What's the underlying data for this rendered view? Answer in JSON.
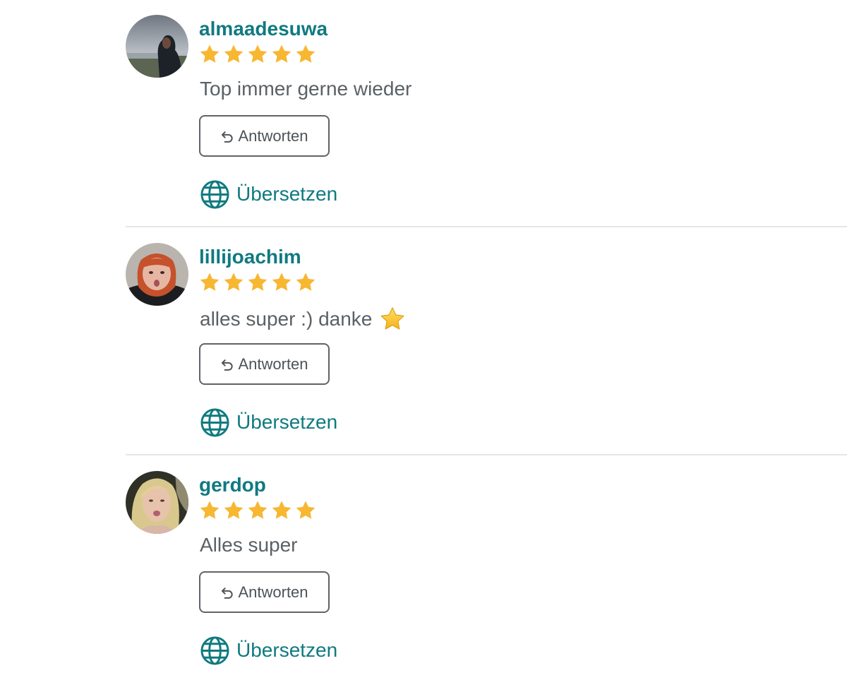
{
  "reviews": [
    {
      "username": "almaadesuwa",
      "rating": 5,
      "comment": "Top immer gerne wieder",
      "comment_emoji": "",
      "reply_label": "Antworten",
      "translate_label": "Übersetzen"
    },
    {
      "username": "lillijoachim",
      "rating": 5,
      "comment": "alles super :) danke",
      "comment_emoji": "star-emoji",
      "reply_label": "Antworten",
      "translate_label": "Übersetzen"
    },
    {
      "username": "gerdop",
      "rating": 5,
      "comment": "Alles super",
      "comment_emoji": "",
      "reply_label": "Antworten",
      "translate_label": "Übersetzen"
    }
  ],
  "colors": {
    "accent": "#0f7a80",
    "star": "#f7b731",
    "text": "#5a6166",
    "border": "#5f6468",
    "divider": "#e4e6e8"
  },
  "icons": {
    "rating": "star-icon",
    "reply": "reply-arrow-icon",
    "translate": "globe-icon"
  }
}
